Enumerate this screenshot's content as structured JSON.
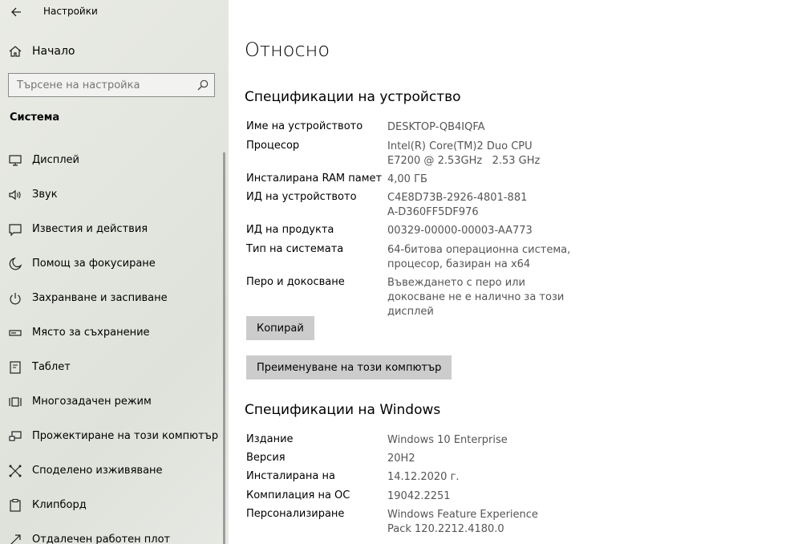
{
  "window": {
    "title": "Настройки"
  },
  "sidebar": {
    "home_label": "Начало",
    "search_placeholder": "Търсене на настройка",
    "section_title": "Система",
    "items": [
      {
        "label": "Дисплей",
        "icon": "monitor-icon"
      },
      {
        "label": "Звук",
        "icon": "speaker-icon"
      },
      {
        "label": "Известия и действия",
        "icon": "notification-icon"
      },
      {
        "label": "Помощ за фокусиране",
        "icon": "moon-icon"
      },
      {
        "label": "Захранване и заспиване",
        "icon": "power-icon"
      },
      {
        "label": "Място за съхранение",
        "icon": "storage-icon"
      },
      {
        "label": "Таблет",
        "icon": "tablet-icon"
      },
      {
        "label": "Многозадачен режим",
        "icon": "multitasking-icon"
      },
      {
        "label": "Прожектиране на този компютър",
        "icon": "projecting-icon"
      },
      {
        "label": "Споделено изживяване",
        "icon": "shared-experience-icon"
      },
      {
        "label": "Клипборд",
        "icon": "clipboard-icon"
      },
      {
        "label": "Отдалечен работен плот",
        "icon": "remote-desktop-icon"
      }
    ]
  },
  "main": {
    "title": "Относно",
    "device_specs": {
      "heading": "Спецификации на устройство",
      "rows": [
        {
          "label": "Име на устройството",
          "value": "DESKTOP-QB4IQFA"
        },
        {
          "label": "Процесор",
          "value": "Intel(R) Core(TM)2 Duo CPU     E7200 @ 2.53GHz   2.53 GHz"
        },
        {
          "label": "Инсталирана RAM памет",
          "value": "4,00 ГБ"
        },
        {
          "label": "ИД на устройството",
          "value": "C4E8D73B-2926-4801-881A-D360FF5DF976"
        },
        {
          "label": "ИД на продукта",
          "value": "00329-00000-00003-AA773"
        },
        {
          "label": "Тип на системата",
          "value": "64-битова операционна система, процесор, базиран на x64"
        },
        {
          "label": "Перо и докосване",
          "value": "Въвеждането с перо или докосване не е налично за този дисплей"
        }
      ],
      "copy_button": "Копирай",
      "rename_button": "Преименуване на този компютър"
    },
    "windows_specs": {
      "heading": "Спецификации на Windows",
      "rows": [
        {
          "label": "Издание",
          "value": "Windows 10 Enterprise"
        },
        {
          "label": "Версия",
          "value": "20H2"
        },
        {
          "label": "Инсталирана на",
          "value": "14.12.2020 г."
        },
        {
          "label": "Компилация на ОС",
          "value": "19042.2251"
        },
        {
          "label": "Персонализиране",
          "value": "Windows Feature Experience Pack 120.2212.4180.0"
        }
      ]
    }
  }
}
